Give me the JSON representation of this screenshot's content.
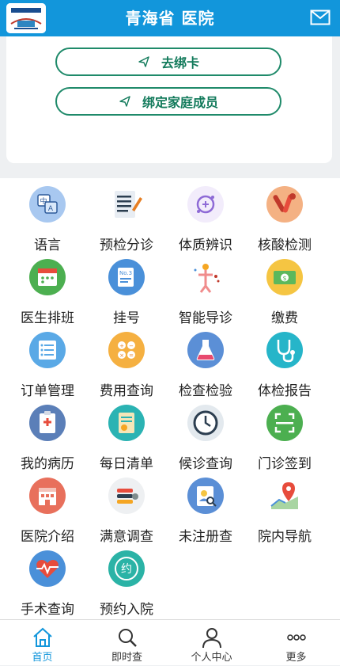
{
  "header": {
    "title": "青海省  医院",
    "logo_icon": "hospital-logo",
    "mail_icon": "mail-icon"
  },
  "card": {
    "buttons": [
      {
        "label": "去绑卡",
        "icon": "send-arrow-icon"
      },
      {
        "label": "绑定家庭成员",
        "icon": "send-arrow-icon"
      }
    ]
  },
  "grid": {
    "items": [
      {
        "label": "语言",
        "icon": "language-icon"
      },
      {
        "label": "预检分诊",
        "icon": "triage-icon"
      },
      {
        "label": "体质辨识",
        "icon": "constitution-icon"
      },
      {
        "label": "核酸检测",
        "icon": "nucleic-test-icon"
      },
      {
        "label": "医生排班",
        "icon": "doctor-schedule-icon"
      },
      {
        "label": "挂号",
        "icon": "register-icon"
      },
      {
        "label": "智能导诊",
        "icon": "smart-guide-icon"
      },
      {
        "label": "缴费",
        "icon": "payment-icon"
      },
      {
        "label": "订单管理",
        "icon": "order-icon"
      },
      {
        "label": "费用查询",
        "icon": "fee-query-icon"
      },
      {
        "label": "检查检验",
        "icon": "lab-flask-icon"
      },
      {
        "label": "体检报告",
        "icon": "stethoscope-icon"
      },
      {
        "label": "我的病历",
        "icon": "medical-record-icon"
      },
      {
        "label": "每日清单",
        "icon": "daily-list-icon"
      },
      {
        "label": "候诊查询",
        "icon": "clock-icon"
      },
      {
        "label": "门诊签到",
        "icon": "scan-checkin-icon"
      },
      {
        "label": "医院介绍",
        "icon": "hospital-intro-icon"
      },
      {
        "label": "满意调查",
        "icon": "survey-icon"
      },
      {
        "label": "未注册查",
        "icon": "unregistered-query-icon"
      },
      {
        "label": "院内导航",
        "icon": "map-pin-icon"
      },
      {
        "label": "手术查询",
        "icon": "heart-pulse-icon"
      },
      {
        "label": "预约入院",
        "icon": "appointment-icon"
      }
    ]
  },
  "nav": {
    "tabs": [
      {
        "label": "首页",
        "icon": "home-icon",
        "active": true
      },
      {
        "label": "即时查",
        "icon": "search-icon",
        "active": false
      },
      {
        "label": "个人中心",
        "icon": "user-icon",
        "active": false
      },
      {
        "label": "更多",
        "icon": "more-dots-icon",
        "active": false
      }
    ]
  },
  "colors": {
    "primary": "#1296db",
    "accent_green": "#1f8a6a"
  }
}
